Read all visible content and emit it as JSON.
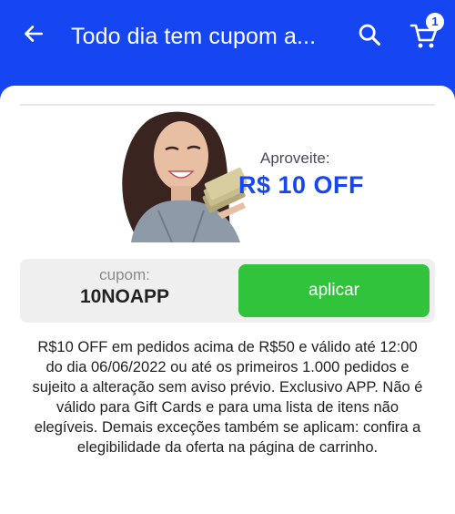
{
  "header": {
    "title": "Todo dia tem cupom a...",
    "cart_count": "1",
    "background_color": "#1646f1",
    "back_icon": "arrow-left-icon",
    "search_icon": "search-icon",
    "cart_icon": "cart-icon"
  },
  "banner": {
    "kicker": "Aproveite:",
    "offer": "R$ 10 OFF",
    "offer_color": "#1646f1",
    "image": "smiling-woman-holding-money-photo"
  },
  "coupon": {
    "label": "cupom:",
    "code": "10NOAPP",
    "apply_label": "aplicar",
    "apply_color": "#32c33c"
  },
  "terms": {
    "text": "R$10 OFF em pedidos acima de R$50 e válido até 12:00 do dia 06/06/2022 ou até os primeiros 1.000 pedidos e sujeito a alteração sem aviso prévio. Exclusivo APP. Não é válido para Gift Cards e para uma lista de itens não elegíveis. Demais exceções também se aplicam: confira a elegibilidade da oferta na página de carrinho."
  }
}
